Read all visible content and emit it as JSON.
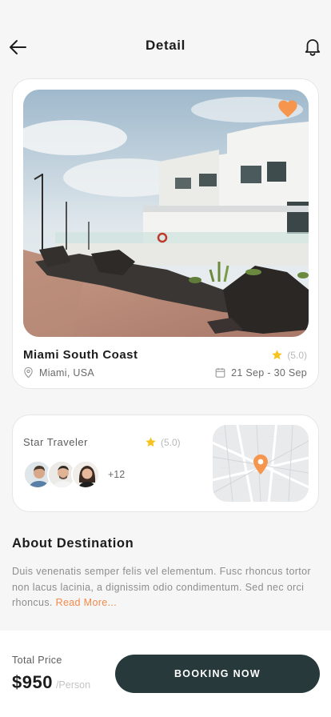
{
  "header": {
    "title": "Detail",
    "back_icon": "arrow-left-icon",
    "bell_icon": "bell-icon"
  },
  "destination": {
    "name": "Miami South Coast",
    "rating": "(5.0)",
    "location": "Miami, USA",
    "dates": "21 Sep - 30 Sep",
    "favorite_icon": "heart-icon",
    "accent_color": "#f5954e"
  },
  "traveler": {
    "title": "Star Traveler",
    "rating": "(5.0)",
    "extra_count": "+12",
    "map_icon": "location-pin-icon"
  },
  "about": {
    "title": "About Destination",
    "text": "Duis venenatis semper felis vel elementum. Fusc rhoncus tortor non lacus lacinia, a dignissim odio condimentum. Sed nec orci rhoncus. ",
    "read_more": "Read More..."
  },
  "footer": {
    "total_label": "Total Price",
    "price": "$950",
    "per": "/Person",
    "book_label": "BOOKING NOW",
    "button_color": "#27393a"
  }
}
